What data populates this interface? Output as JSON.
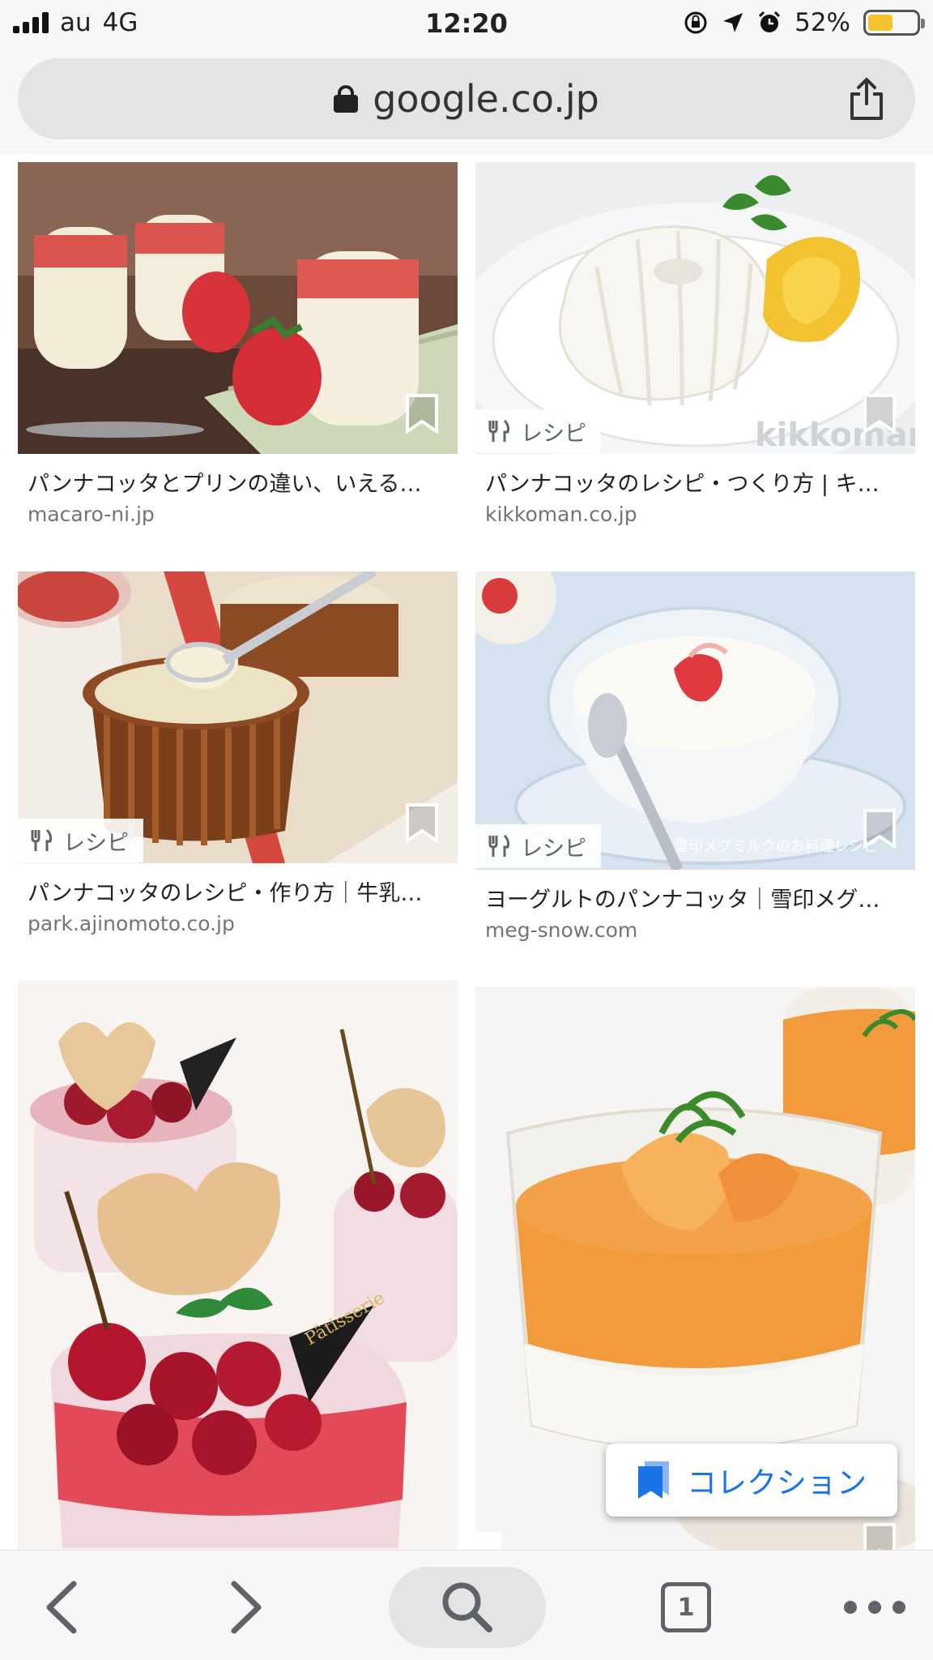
{
  "status_bar": {
    "carrier": "au",
    "network": "4G",
    "time": "12:20",
    "battery_percent": "52%",
    "battery_level": 0.52,
    "icons": [
      "signal-icon",
      "orientation-lock-icon",
      "location-arrow-icon",
      "alarm-icon",
      "battery-icon"
    ]
  },
  "url_bar": {
    "domain": "google.co.jp",
    "icons": [
      "lock-icon",
      "share-icon"
    ]
  },
  "results": [
    {
      "title": "パンナコッタとプリンの違い、いえる…",
      "site": "macaro-ni.jp",
      "badge": ""
    },
    {
      "title": "パンナコッタのレシピ・つくり方 | キ…",
      "site": "kikkoman.co.jp",
      "badge": "レシピ"
    },
    {
      "title": "パンナコッタのレシピ・作り方｜牛乳…",
      "site": "park.ajinomoto.co.jp",
      "badge": "レシピ"
    },
    {
      "title": "ヨーグルトのパンナコッタ｜雪印メグ…",
      "site": "meg-snow.com",
      "badge": "レシピ"
    },
    {
      "title": "",
      "site": "",
      "badge": ""
    },
    {
      "title": "",
      "site": "",
      "badge": ""
    }
  ],
  "collection_button": {
    "label": "コレクション",
    "color": "#1a73e8"
  },
  "toolbar": {
    "tab_count": "1",
    "icons": [
      "back-icon",
      "forward-icon",
      "search-icon",
      "tabs-icon",
      "more-icon"
    ]
  }
}
